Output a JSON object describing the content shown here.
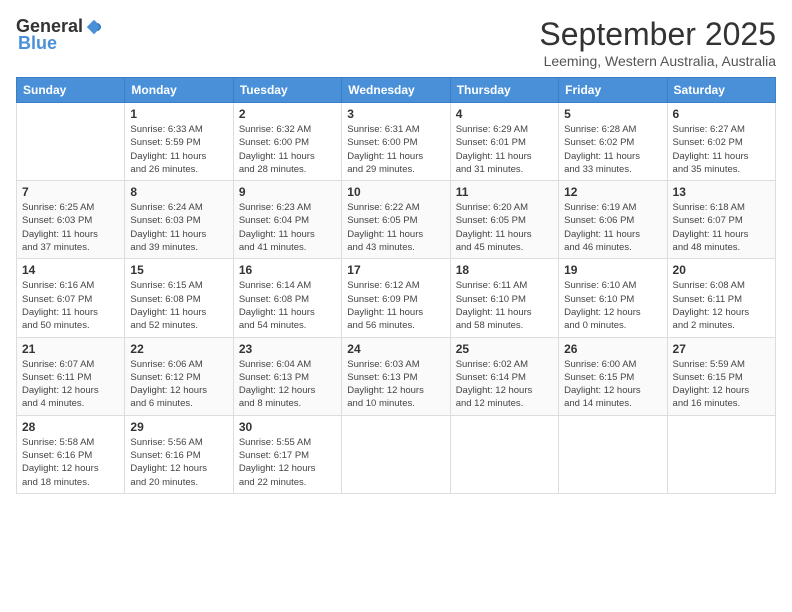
{
  "header": {
    "logo_general": "General",
    "logo_blue": "Blue",
    "title": "September 2025",
    "location": "Leeming, Western Australia, Australia"
  },
  "calendar": {
    "days_of_week": [
      "Sunday",
      "Monday",
      "Tuesday",
      "Wednesday",
      "Thursday",
      "Friday",
      "Saturday"
    ],
    "weeks": [
      [
        {
          "day": "",
          "info": ""
        },
        {
          "day": "1",
          "info": "Sunrise: 6:33 AM\nSunset: 5:59 PM\nDaylight: 11 hours\nand 26 minutes."
        },
        {
          "day": "2",
          "info": "Sunrise: 6:32 AM\nSunset: 6:00 PM\nDaylight: 11 hours\nand 28 minutes."
        },
        {
          "day": "3",
          "info": "Sunrise: 6:31 AM\nSunset: 6:00 PM\nDaylight: 11 hours\nand 29 minutes."
        },
        {
          "day": "4",
          "info": "Sunrise: 6:29 AM\nSunset: 6:01 PM\nDaylight: 11 hours\nand 31 minutes."
        },
        {
          "day": "5",
          "info": "Sunrise: 6:28 AM\nSunset: 6:02 PM\nDaylight: 11 hours\nand 33 minutes."
        },
        {
          "day": "6",
          "info": "Sunrise: 6:27 AM\nSunset: 6:02 PM\nDaylight: 11 hours\nand 35 minutes."
        }
      ],
      [
        {
          "day": "7",
          "info": "Sunrise: 6:25 AM\nSunset: 6:03 PM\nDaylight: 11 hours\nand 37 minutes."
        },
        {
          "day": "8",
          "info": "Sunrise: 6:24 AM\nSunset: 6:03 PM\nDaylight: 11 hours\nand 39 minutes."
        },
        {
          "day": "9",
          "info": "Sunrise: 6:23 AM\nSunset: 6:04 PM\nDaylight: 11 hours\nand 41 minutes."
        },
        {
          "day": "10",
          "info": "Sunrise: 6:22 AM\nSunset: 6:05 PM\nDaylight: 11 hours\nand 43 minutes."
        },
        {
          "day": "11",
          "info": "Sunrise: 6:20 AM\nSunset: 6:05 PM\nDaylight: 11 hours\nand 45 minutes."
        },
        {
          "day": "12",
          "info": "Sunrise: 6:19 AM\nSunset: 6:06 PM\nDaylight: 11 hours\nand 46 minutes."
        },
        {
          "day": "13",
          "info": "Sunrise: 6:18 AM\nSunset: 6:07 PM\nDaylight: 11 hours\nand 48 minutes."
        }
      ],
      [
        {
          "day": "14",
          "info": "Sunrise: 6:16 AM\nSunset: 6:07 PM\nDaylight: 11 hours\nand 50 minutes."
        },
        {
          "day": "15",
          "info": "Sunrise: 6:15 AM\nSunset: 6:08 PM\nDaylight: 11 hours\nand 52 minutes."
        },
        {
          "day": "16",
          "info": "Sunrise: 6:14 AM\nSunset: 6:08 PM\nDaylight: 11 hours\nand 54 minutes."
        },
        {
          "day": "17",
          "info": "Sunrise: 6:12 AM\nSunset: 6:09 PM\nDaylight: 11 hours\nand 56 minutes."
        },
        {
          "day": "18",
          "info": "Sunrise: 6:11 AM\nSunset: 6:10 PM\nDaylight: 11 hours\nand 58 minutes."
        },
        {
          "day": "19",
          "info": "Sunrise: 6:10 AM\nSunset: 6:10 PM\nDaylight: 12 hours\nand 0 minutes."
        },
        {
          "day": "20",
          "info": "Sunrise: 6:08 AM\nSunset: 6:11 PM\nDaylight: 12 hours\nand 2 minutes."
        }
      ],
      [
        {
          "day": "21",
          "info": "Sunrise: 6:07 AM\nSunset: 6:11 PM\nDaylight: 12 hours\nand 4 minutes."
        },
        {
          "day": "22",
          "info": "Sunrise: 6:06 AM\nSunset: 6:12 PM\nDaylight: 12 hours\nand 6 minutes."
        },
        {
          "day": "23",
          "info": "Sunrise: 6:04 AM\nSunset: 6:13 PM\nDaylight: 12 hours\nand 8 minutes."
        },
        {
          "day": "24",
          "info": "Sunrise: 6:03 AM\nSunset: 6:13 PM\nDaylight: 12 hours\nand 10 minutes."
        },
        {
          "day": "25",
          "info": "Sunrise: 6:02 AM\nSunset: 6:14 PM\nDaylight: 12 hours\nand 12 minutes."
        },
        {
          "day": "26",
          "info": "Sunrise: 6:00 AM\nSunset: 6:15 PM\nDaylight: 12 hours\nand 14 minutes."
        },
        {
          "day": "27",
          "info": "Sunrise: 5:59 AM\nSunset: 6:15 PM\nDaylight: 12 hours\nand 16 minutes."
        }
      ],
      [
        {
          "day": "28",
          "info": "Sunrise: 5:58 AM\nSunset: 6:16 PM\nDaylight: 12 hours\nand 18 minutes."
        },
        {
          "day": "29",
          "info": "Sunrise: 5:56 AM\nSunset: 6:16 PM\nDaylight: 12 hours\nand 20 minutes."
        },
        {
          "day": "30",
          "info": "Sunrise: 5:55 AM\nSunset: 6:17 PM\nDaylight: 12 hours\nand 22 minutes."
        },
        {
          "day": "",
          "info": ""
        },
        {
          "day": "",
          "info": ""
        },
        {
          "day": "",
          "info": ""
        },
        {
          "day": "",
          "info": ""
        }
      ]
    ]
  }
}
